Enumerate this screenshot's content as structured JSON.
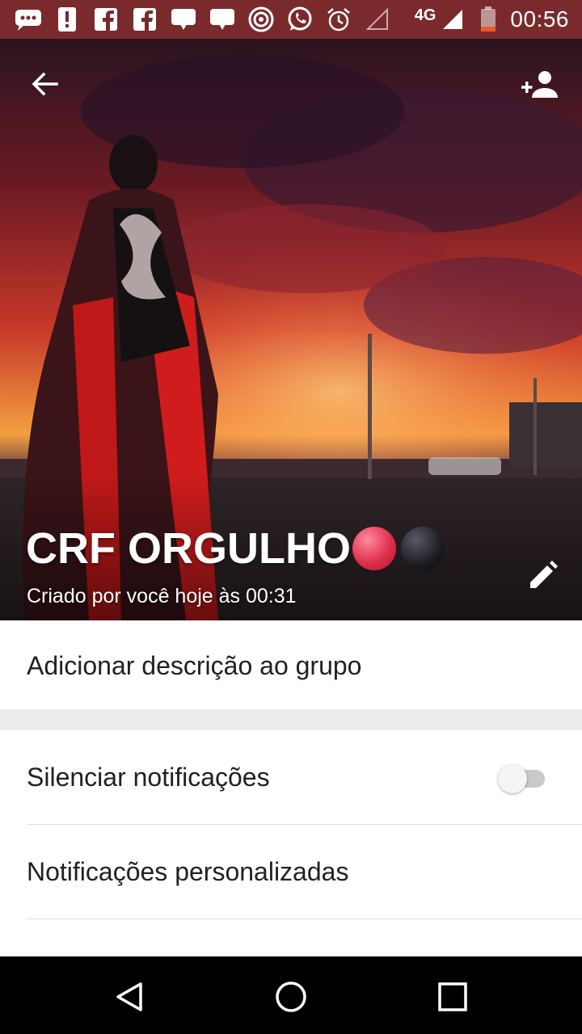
{
  "status_bar": {
    "network": "4G",
    "time": "00:56",
    "icons": [
      "chat-bubble-dots-icon",
      "alert-icon",
      "facebook-icon",
      "facebook-icon",
      "message-icon",
      "message-icon",
      "target-icon",
      "whatsapp-icon",
      "alarm-icon",
      "signal-empty-icon",
      "signal-icon",
      "battery-low-icon"
    ]
  },
  "header": {
    "back_icon": "arrow-left-icon",
    "add_participant_icon": "person-add-icon",
    "edit_icon": "pencil-icon",
    "group_name": "CRF ORGULHO",
    "emoji_colors": [
      "#e0304a",
      "#1c1c22"
    ],
    "created_text": "Criado por você hoje às 00:31"
  },
  "description": {
    "label": "Adicionar descrição ao grupo"
  },
  "settings": {
    "mute_label": "Silenciar notificações",
    "mute_enabled": false,
    "custom_label": "Notificações personalizadas"
  },
  "nav": {
    "back": "triangle-back-icon",
    "home": "circle-home-icon",
    "recents": "square-recents-icon"
  },
  "colors": {
    "status_bar": "#7a2a2c",
    "text_primary": "#212121"
  }
}
